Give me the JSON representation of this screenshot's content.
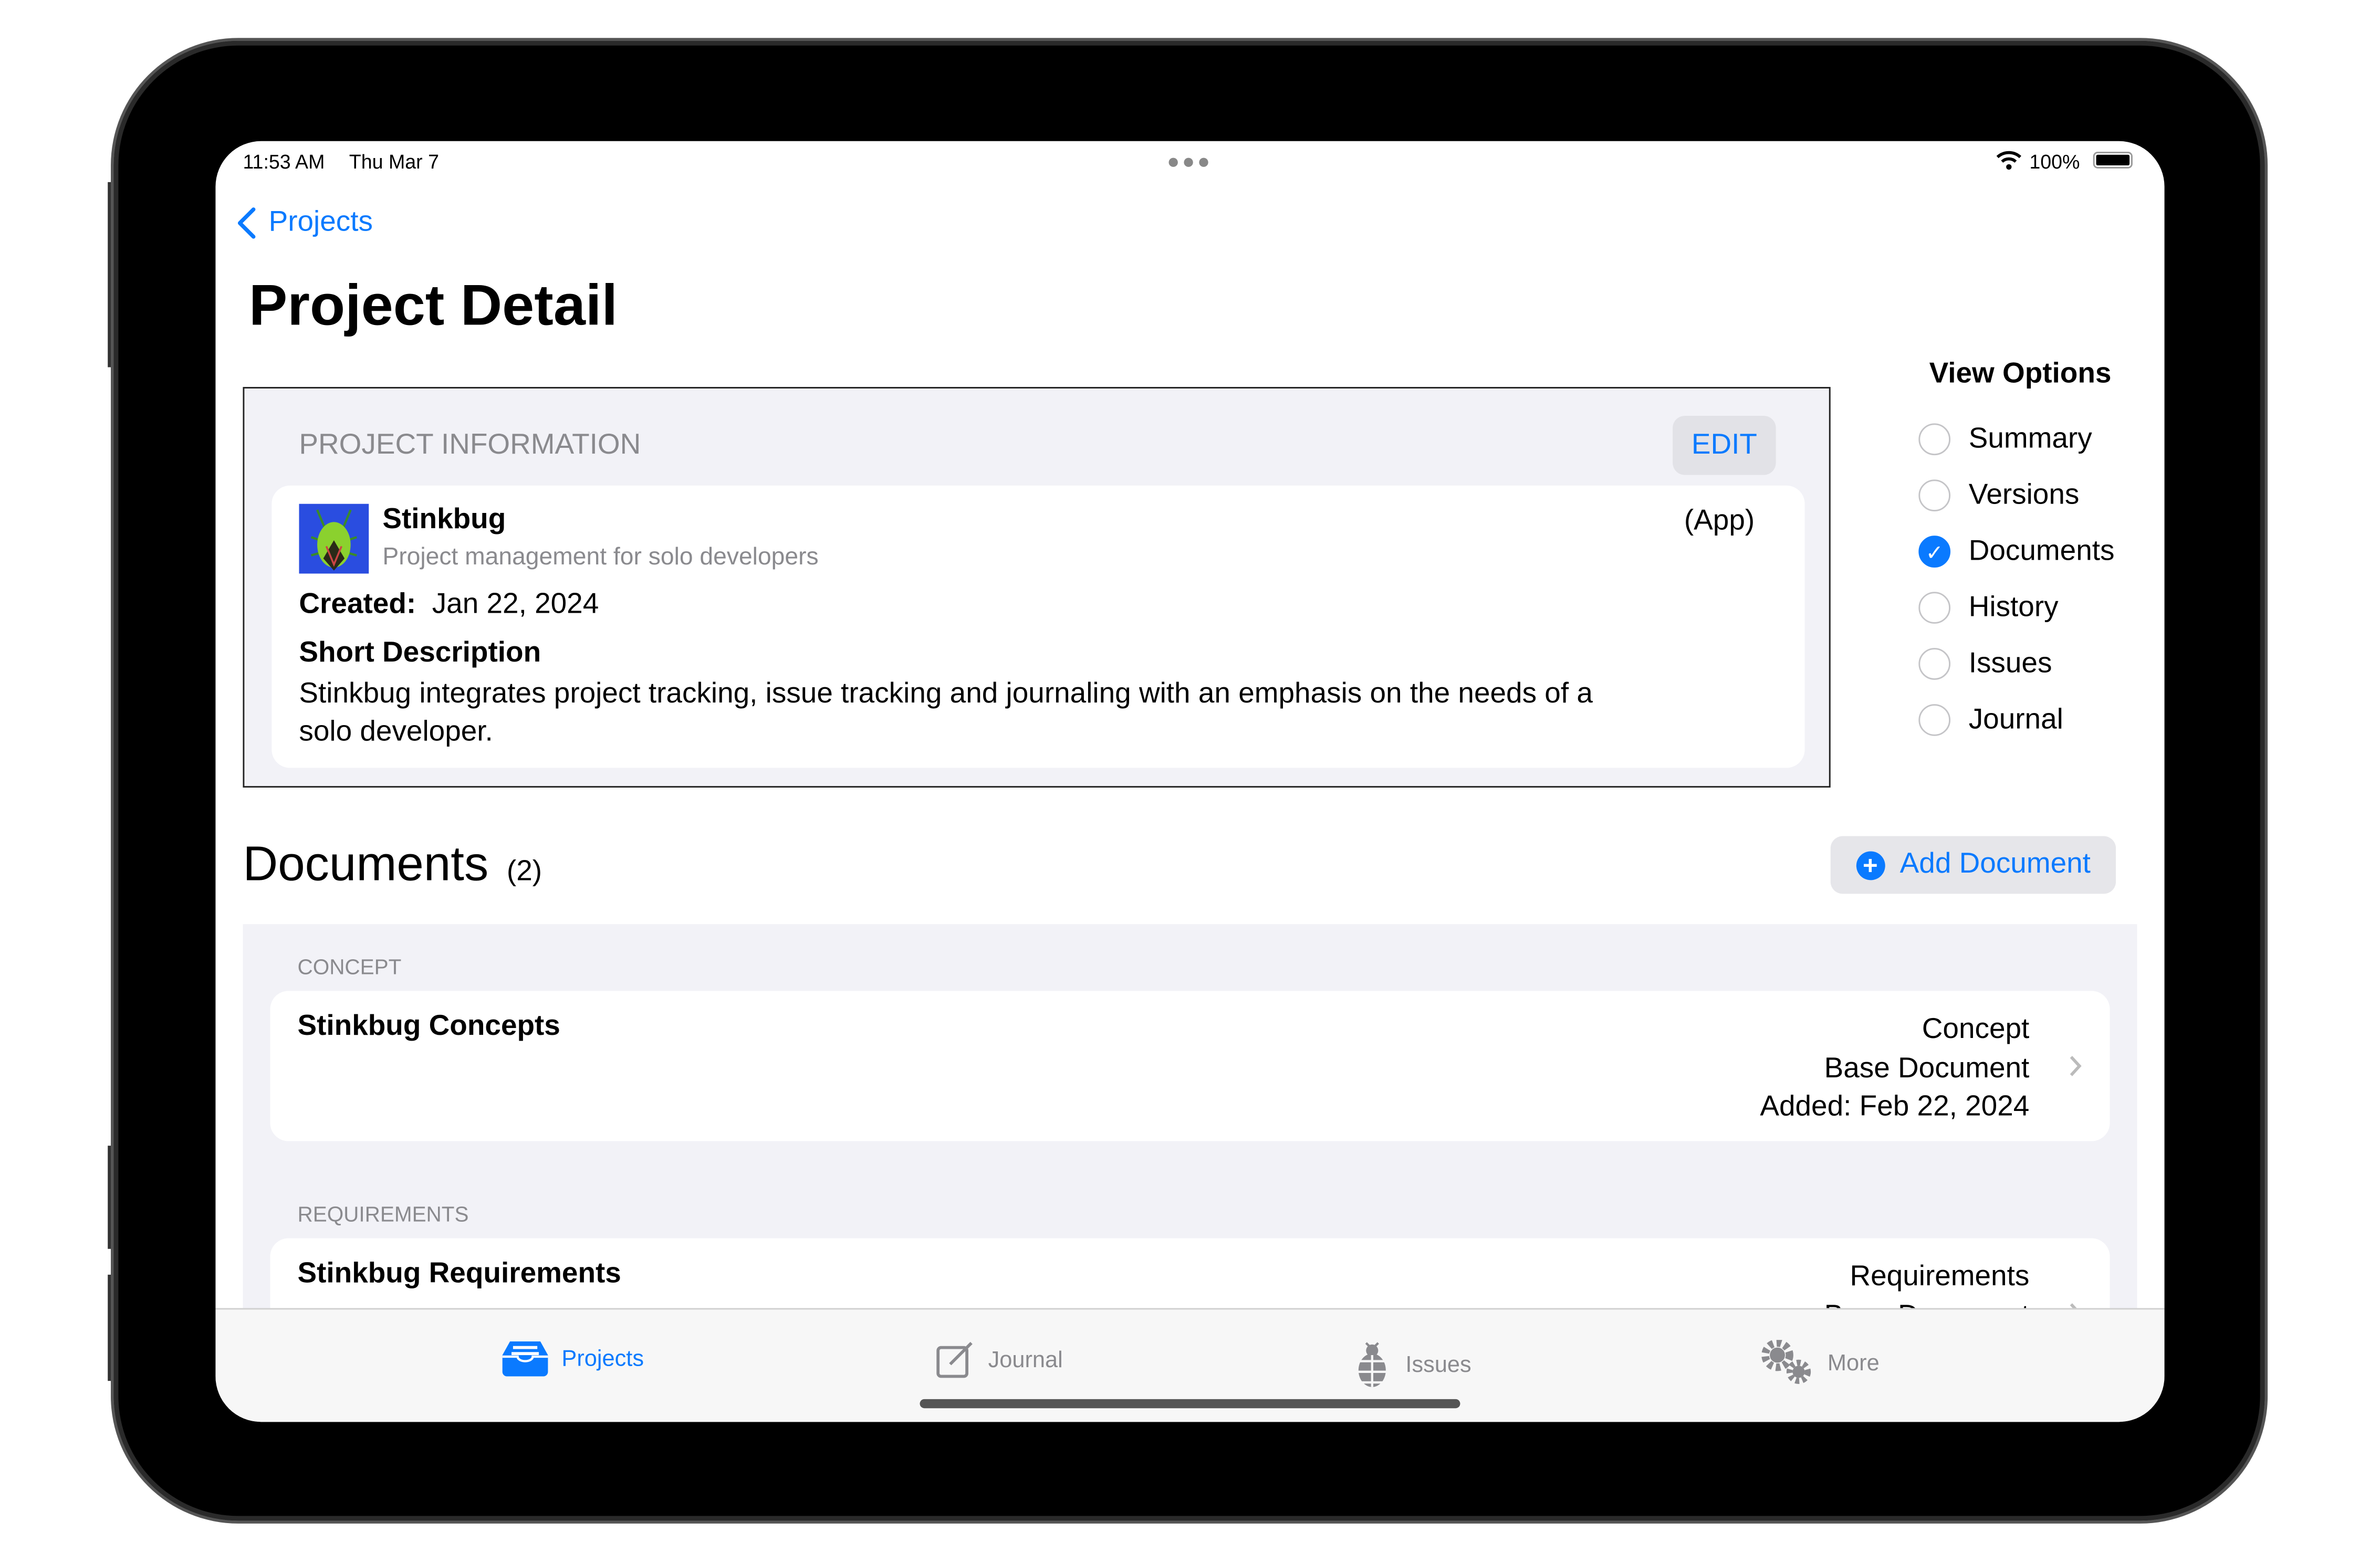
{
  "status_bar": {
    "time": "11:53 AM",
    "date": "Thu Mar 7",
    "battery": "100%",
    "battery_level": 1.0
  },
  "nav": {
    "back_label": "Projects",
    "title": "Project Detail"
  },
  "project_info": {
    "header": "PROJECT INFORMATION",
    "edit_label": "EDIT",
    "name": "Stinkbug",
    "subtitle": "Project management for solo developers",
    "type": "(App)",
    "created_label": "Created:",
    "created_value": "Jan 22, 2024",
    "short_desc_label": "Short Description",
    "short_desc": "Stinkbug integrates project tracking, issue tracking and journaling with an emphasis on the needs of a solo developer."
  },
  "view_options": {
    "title": "View Options",
    "items": [
      {
        "label": "Summary",
        "selected": false
      },
      {
        "label": "Versions",
        "selected": false
      },
      {
        "label": "Documents",
        "selected": true
      },
      {
        "label": "History",
        "selected": false
      },
      {
        "label": "Issues",
        "selected": false
      },
      {
        "label": "Journal",
        "selected": false
      }
    ]
  },
  "documents": {
    "title": "Documents",
    "count": "(2)",
    "add_label": "Add Document",
    "sections": [
      {
        "header": "CONCEPT",
        "name": "Stinkbug Concepts",
        "type": "Concept",
        "kind": "Base Document",
        "added": "Added: Feb 22, 2024"
      },
      {
        "header": "REQUIREMENTS",
        "name": "Stinkbug Requirements",
        "type": "Requirements",
        "kind": "Base Document"
      }
    ]
  },
  "tabs": [
    {
      "label": "Projects",
      "icon": "tray-icon",
      "active": true
    },
    {
      "label": "Journal",
      "icon": "compose-icon",
      "active": false
    },
    {
      "label": "Issues",
      "icon": "bug-icon",
      "active": false
    },
    {
      "label": "More",
      "icon": "gears-icon",
      "active": false
    }
  ],
  "colors": {
    "accent": "#0a7aff",
    "grouped_bg": "#f2f2f7"
  }
}
